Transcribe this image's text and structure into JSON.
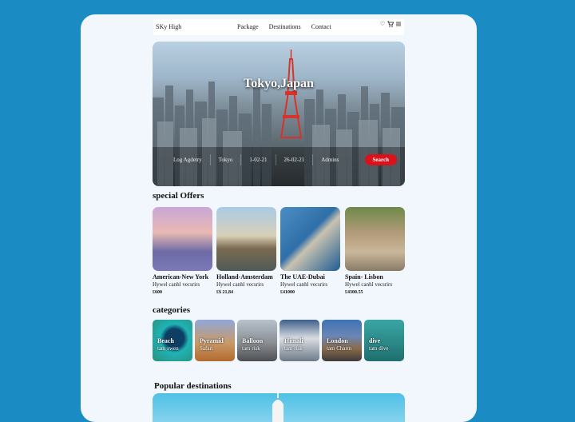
{
  "nav": {
    "brand": "SKy High",
    "links": [
      "Package",
      "Destinations",
      "Contact"
    ],
    "icons": [
      "heart-icon",
      "cart-icon",
      "menu-icon"
    ]
  },
  "hero": {
    "title": "Tokyo,Japan",
    "search": {
      "fields": [
        "Log Agdetry",
        "Tokyo",
        "1-02-21",
        "26-02-21",
        "Admins"
      ],
      "button": "Search"
    }
  },
  "offers": {
    "title": "special Offers",
    "items": [
      {
        "name": "American-New York",
        "desc": "Hywel canhl vecsrirs",
        "price": "£600"
      },
      {
        "name": "Holland-Amsterdam",
        "desc": "Hywel canhl vecsrirs",
        "price": "£$ 21,84"
      },
      {
        "name": "The UAE-Dubai",
        "desc": "Hywel canhl vecsrirs",
        "price": "£41000"
      },
      {
        "name": "Spain- Lisbon",
        "desc": "Hywel canhl vecsrirs",
        "price": "£4300.55"
      }
    ]
  },
  "categories": {
    "title": "categories",
    "items": [
      {
        "name": "Beach",
        "sub": "tam swen"
      },
      {
        "name": "Pyramid",
        "sub": "Safari"
      },
      {
        "name": "Balloon",
        "sub": "tam risk"
      },
      {
        "name": "Himali",
        "sub": "tam risk"
      },
      {
        "name": "London",
        "sub": "tam Charm"
      },
      {
        "name": "dive",
        "sub": "tam dive"
      }
    ]
  },
  "popular": {
    "title": "Popular destinations"
  },
  "colors": {
    "background": "#1a8bc3",
    "card": "#f1f7fd",
    "accent": "#d9121b"
  }
}
